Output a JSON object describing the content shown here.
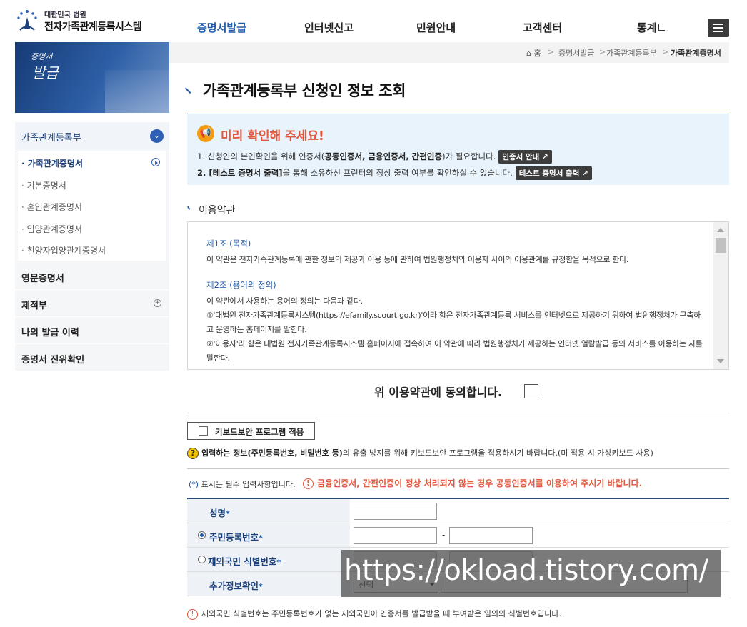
{
  "header": {
    "logo_small": "대한민국 법원",
    "logo_big": "전자가족관계등록시스템",
    "nav": [
      "증명서발급",
      "인터넷신고",
      "민원안내",
      "고객센터",
      "통계"
    ]
  },
  "sidebar": {
    "banner_line1": "증명서",
    "banner_line2": "발급",
    "group_label": "가족관계등록부",
    "sub_items": [
      "· 가족관계증명서",
      "· 기본증명서",
      "· 혼인관계증명서",
      "· 입양관계증명서",
      "· 친양자입양관계증명서"
    ],
    "main_items": [
      "영문증명서",
      "제적부",
      "나의 발급 이력",
      "증명서 진위확인"
    ]
  },
  "breadcrumb": {
    "home": "홈",
    "items": [
      "증명서발급",
      "가족관계등록부",
      "가족관계증명서"
    ]
  },
  "page": {
    "title": "가족관계등록부 신청인 정보 조회"
  },
  "notice": {
    "title": "미리 확인해 주세요!",
    "line1_pre": "1. 신청인의 본인확인을 위해 인증서(",
    "line1_bold": "공동인증서, 금융인증서, 간편인증",
    "line1_post": ")가 필요합니다.",
    "line1_btn": "인증서 안내",
    "line2_bold": "2. [테스트 증명서 출력]",
    "line2_post": "을 통해 소유하신 프린터의 정상 출력 여부를 확인하실 수 있습니다.",
    "line2_btn": "테스트 증명서 출력"
  },
  "terms": {
    "section_title": "이용약관",
    "art1_title": "제1조 (목적)",
    "art1_body": "이 약관은 전자가족관계등록에 관한 정보의 제공과 이용 등에 관하여 법원행정처와 이용자 사이의 이용관계를 규정함을 목적으로 한다.",
    "art2_title": "제2조 (용어의 정의)",
    "art2_intro": "이 약관에서 사용하는 용어의 정의는 다음과 같다.",
    "art2_item1": "①'대법원 전자가족관계등록시스템(https://efamily.scourt.go.kr)'이라 함은 전자가족관계등록 서비스를 인터넷으로 제공하기 위하여 법원행정처가 구축하고 운영하는 홈페이지를 말한다.",
    "art2_item2": "②'이용자'라 함은 대법원 전자가족관계등록시스템 홈페이지에 접속하여 이 약관에 따라 법원행정처가 제공하는 인터넷 열람발급 등의 서비스를 이용하는 자를 말한다."
  },
  "agree": {
    "label": "위 이용약관에 동의합니다."
  },
  "keyboard": {
    "button": "키보드보안 프로그램 적용",
    "note_bold": "입력하는 정보(주민등록번호, 비밀번호 등)",
    "note_post": "의 유출 방지를 위해 키보드보안 프로그램을 적용하시기 바랍니다.(미 적용 시 가상키보드 사용)"
  },
  "form": {
    "required_note_star": "(*)",
    "required_note": " 표시는 필수 입력사항입니다.",
    "warning": "금융인증서, 간편인증이 정상 처리되지 않는 경우 공동인증서를 이용하여 주시기 바랍니다.",
    "name_label": "성명",
    "rrn_label": "주민등록번호",
    "foreign_label": "재외국민 식별번호",
    "extra_label": "추가정보확인",
    "select_value": "선택",
    "dash": "-",
    "bottom_note": "재외국민 식별번호는 주민등록번호가 없는 재외국민이 인증서를 발급받을 때 부여받은 임의의 식별번호입니다."
  },
  "watermark": "https://okload.tistory.com/",
  "colors": {
    "accent": "#1f5aa8",
    "warning": "#e2573d",
    "notice_bg": "#e9f3fb"
  }
}
